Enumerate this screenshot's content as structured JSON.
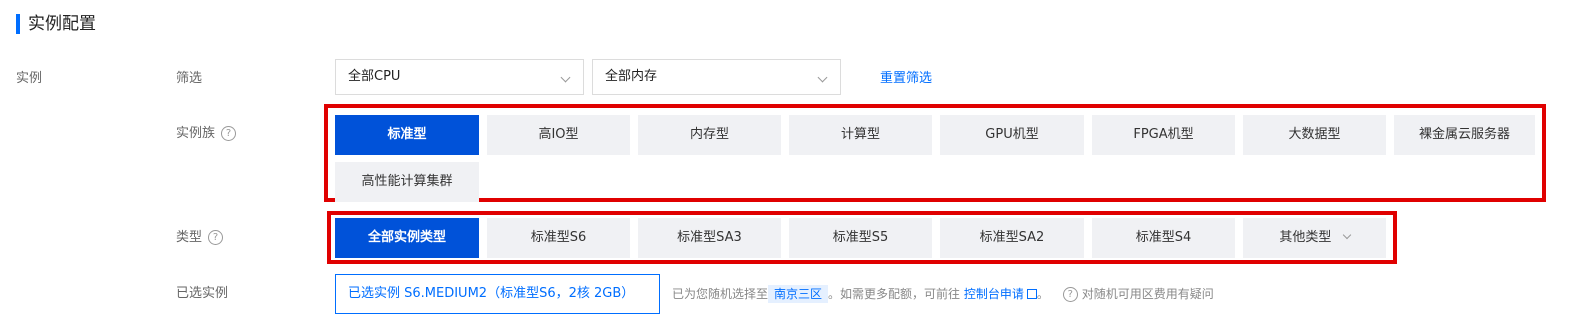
{
  "section": {
    "title": "实例配置"
  },
  "rows": {
    "instance": "实例",
    "filter": "筛选",
    "family": "实例族",
    "type": "类型",
    "selected": "已选实例"
  },
  "filters": {
    "cpu": "全部CPU",
    "memory": "全部内存",
    "reset": "重置筛选"
  },
  "families": [
    {
      "label": "标准型",
      "active": true
    },
    {
      "label": "高IO型",
      "active": false
    },
    {
      "label": "内存型",
      "active": false
    },
    {
      "label": "计算型",
      "active": false
    },
    {
      "label": "GPU机型",
      "active": false
    },
    {
      "label": "FPGA机型",
      "active": false
    },
    {
      "label": "大数据型",
      "active": false
    },
    {
      "label": "裸金属云服务器",
      "active": false
    },
    {
      "label": "高性能计算集群",
      "active": false
    }
  ],
  "types": [
    {
      "label": "全部实例类型",
      "active": true
    },
    {
      "label": "标准型S6",
      "active": false
    },
    {
      "label": "标准型SA3",
      "active": false
    },
    {
      "label": "标准型S5",
      "active": false
    },
    {
      "label": "标准型SA2",
      "active": false
    },
    {
      "label": "标准型S4",
      "active": false
    },
    {
      "label": "其他类型",
      "active": false
    }
  ],
  "selected_instance": {
    "value": "已选实例 S6.MEDIUM2（标准型S6，2核 2GB）",
    "hint_prefix": "已为您随机选择至",
    "region": "南京三区",
    "hint_middle": "。如需更多配额，可前往",
    "console_link": "控制台申请",
    "hint_end": "。",
    "faq": "对随机可用区费用有疑问"
  },
  "colors": {
    "accent": "#006eff",
    "active_chip": "#0052d9",
    "highlight_box": "#e00000"
  }
}
